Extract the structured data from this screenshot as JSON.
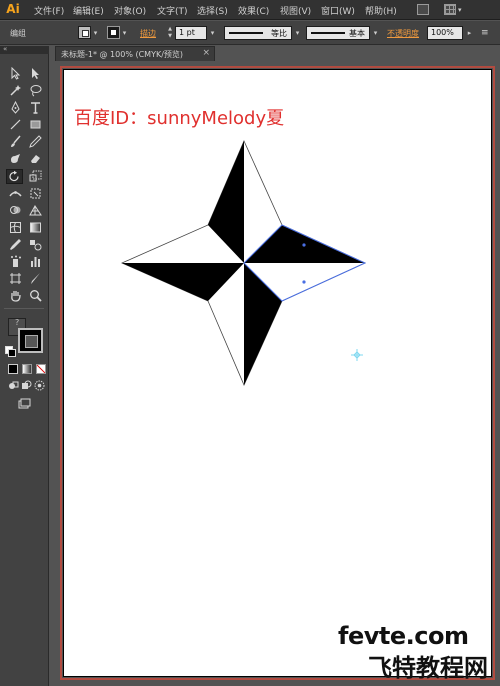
{
  "app": {
    "logo": "Ai",
    "menu": [
      "文件(F)",
      "编辑(E)",
      "对象(O)",
      "文字(T)",
      "选择(S)",
      "效果(C)",
      "视图(V)",
      "窗口(W)",
      "帮助(H)"
    ]
  },
  "control_bar": {
    "selection_label": "编组",
    "stroke_link": "描边",
    "stroke_weight": "1 pt",
    "profile_label": "等比",
    "brush_label": "基本",
    "opacity_link": "不透明度",
    "opacity_value": "100%"
  },
  "document": {
    "tab_title": "未标题-1* @ 100% (CMYK/预览)",
    "close_glyph": "×"
  },
  "artwork": {
    "credit_text": "百度ID：sunnyMelody夏",
    "credit_color": "#e0302e",
    "fill_color": "#000000",
    "selection_color": "#4a6fe3"
  },
  "watermark": {
    "domain": "fevte.com",
    "chinese": "飞特教程网"
  },
  "tools": [
    "selection-tool",
    "direct-selection-tool",
    "magic-wand-tool",
    "lasso-tool",
    "pen-tool",
    "type-tool",
    "line-tool",
    "rectangle-tool",
    "paintbrush-tool",
    "pencil-tool",
    "blob-brush-tool",
    "eraser-tool",
    "rotate-tool",
    "scale-tool",
    "width-tool",
    "free-transform-tool",
    "shape-builder-tool",
    "perspective-grid-tool",
    "mesh-tool",
    "gradient-tool",
    "eyedropper-tool",
    "blend-tool",
    "symbol-sprayer-tool",
    "column-graph-tool",
    "artboard-tool",
    "slice-tool",
    "hand-tool",
    "zoom-tool"
  ]
}
